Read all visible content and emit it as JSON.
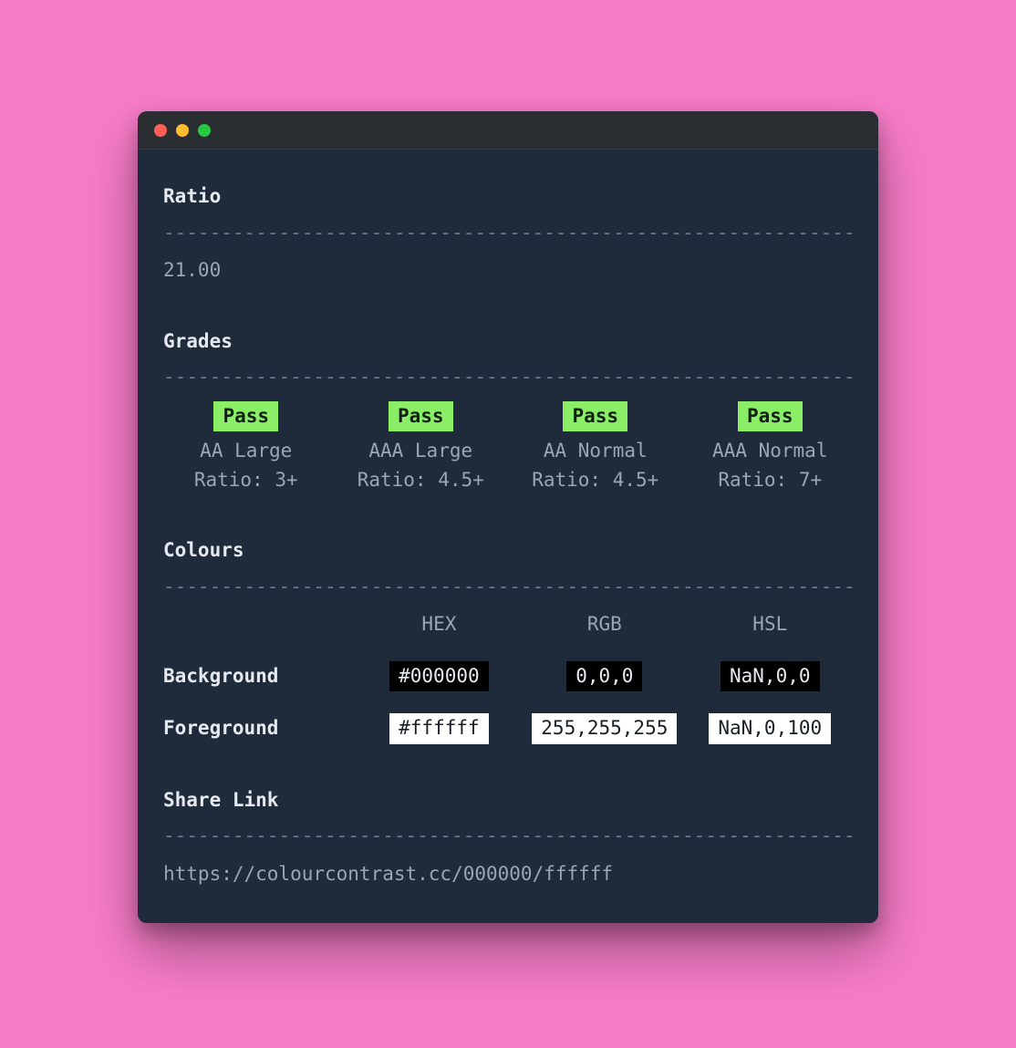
{
  "ratio": {
    "heading": "Ratio",
    "value": "21.00"
  },
  "grades": {
    "heading": "Grades",
    "items": [
      {
        "status": "Pass",
        "label": "AA Large",
        "ratio": "Ratio: 3+"
      },
      {
        "status": "Pass",
        "label": "AAA Large",
        "ratio": "Ratio: 4.5+"
      },
      {
        "status": "Pass",
        "label": "AA Normal",
        "ratio": "Ratio: 4.5+"
      },
      {
        "status": "Pass",
        "label": "AAA Normal",
        "ratio": "Ratio: 7+"
      }
    ]
  },
  "colours": {
    "heading": "Colours",
    "headers": {
      "hex": "HEX",
      "rgb": "RGB",
      "hsl": "HSL"
    },
    "rows": [
      {
        "label": "Background",
        "hex": "#000000",
        "rgb": "0,0,0",
        "hsl": "NaN,0,0",
        "swatch_class": "swatch-bg"
      },
      {
        "label": "Foreground",
        "hex": "#ffffff",
        "rgb": "255,255,255",
        "hsl": "NaN,0,100",
        "swatch_class": "swatch-fg"
      }
    ]
  },
  "share": {
    "heading": "Share Link",
    "url": "https://colourcontrast.cc/000000/ffffff"
  },
  "dash_line": "---------------------------------------------------------------"
}
